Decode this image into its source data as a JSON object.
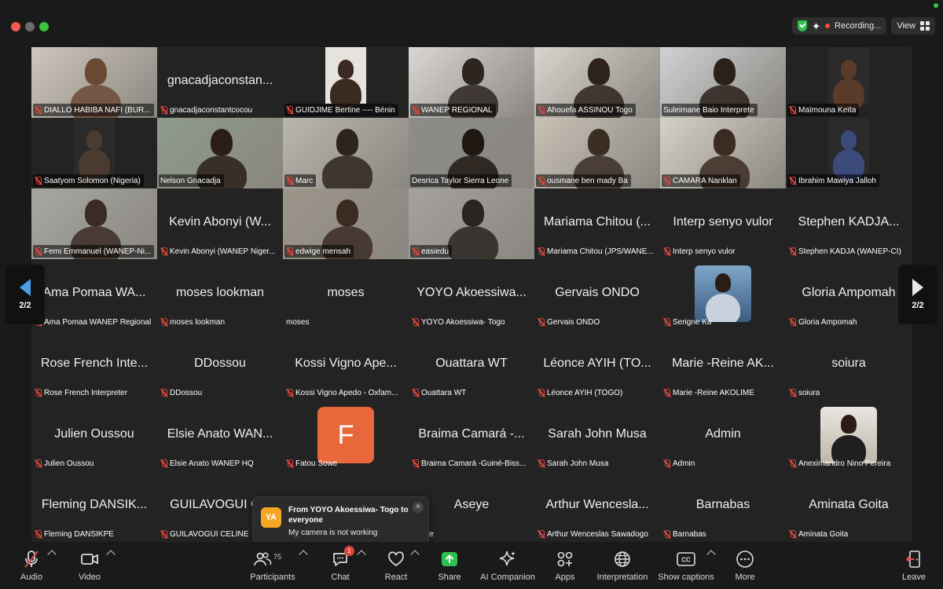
{
  "topbar": {
    "recording_label": "Recording...",
    "view_label": "View"
  },
  "grid": [
    {
      "big": "",
      "label": "DIALLO HABIBA NAFI (BUR...",
      "video": true,
      "muted": true
    },
    {
      "big": "gnacadjaconstan...",
      "label": "gnacadjaconstantcocou",
      "video": false,
      "muted": true
    },
    {
      "big": "",
      "label": "GUIDJIME Bertine ----  Bénin",
      "video": true,
      "muted": true
    },
    {
      "big": "",
      "label": "WANEP REGIONAL",
      "video": true,
      "muted": true
    },
    {
      "big": "",
      "label": "Ahouefa ASSINOU Togo",
      "video": true,
      "muted": true
    },
    {
      "big": "",
      "label": "Suleimane Baio Interprete",
      "video": true,
      "muted": false
    },
    {
      "big": "",
      "label": "Maïmouna Keïta",
      "video": true,
      "muted": true
    },
    {
      "big": "",
      "label": "Saatyom Solomon (Nigeria)",
      "video": true,
      "muted": true
    },
    {
      "big": "",
      "label": "Nelson Gnacadja",
      "video": true,
      "muted": false,
      "active": true
    },
    {
      "big": "",
      "label": "Marc",
      "video": true,
      "muted": true
    },
    {
      "big": "",
      "label": "Desrica Taylor Sierra Leone",
      "video": true,
      "muted": false
    },
    {
      "big": "",
      "label": "ousmane ben mady Ba",
      "video": true,
      "muted": true
    },
    {
      "big": "",
      "label": "CAMARA Nanklan",
      "video": true,
      "muted": true
    },
    {
      "big": "",
      "label": "Ibrahim Mawiya Jalloh",
      "video": true,
      "muted": true
    },
    {
      "big": "",
      "label": "Femi Emmanuel (WANEP-Ni...",
      "video": true,
      "muted": true
    },
    {
      "big": "Kevin Abonyi (W...",
      "label": "Kevin Abonyi (WANEP Niger...",
      "video": false,
      "muted": true
    },
    {
      "big": "",
      "label": "edwige mensah",
      "video": true,
      "muted": true
    },
    {
      "big": "",
      "label": "easiedu",
      "video": true,
      "muted": true
    },
    {
      "big": "Mariama Chitou (...",
      "label": "Mariama Chitou (JPS/WANE...",
      "video": false,
      "muted": true
    },
    {
      "big": "Interp senyo vulor",
      "label": "Interp senyo vulor",
      "video": false,
      "muted": true
    },
    {
      "big": "Stephen KADJA...",
      "label": "Stephen KADJA (WANEP-CI)",
      "video": false,
      "muted": true
    },
    {
      "big": "Ama Pomaa WA...",
      "label": "Ama Pomaa WANEP Regional",
      "video": false,
      "muted": true
    },
    {
      "big": "moses lookman",
      "label": "moses lookman",
      "video": false,
      "muted": true
    },
    {
      "big": "moses",
      "label": "moses",
      "video": false,
      "muted": false
    },
    {
      "big": "YOYO Akoessiwa...",
      "label": "YOYO Akoessiwa- Togo",
      "video": false,
      "muted": true
    },
    {
      "big": "Gervais ONDO",
      "label": "Gervais ONDO",
      "video": false,
      "muted": true
    },
    {
      "big": "",
      "label": "Serigne Ka",
      "video": false,
      "muted": true,
      "photo": "portrait-man"
    },
    {
      "big": "Gloria Ampomah",
      "label": "Gloria Ampomah",
      "video": false,
      "muted": true
    },
    {
      "big": "Rose French Inte...",
      "label": "Rose French Interpreter",
      "video": false,
      "muted": true
    },
    {
      "big": "DDossou",
      "label": "DDossou",
      "video": false,
      "muted": true
    },
    {
      "big": "Kossi Vigno Ape...",
      "label": "Kossi Vigno Apedo - Oxfam...",
      "video": false,
      "muted": true
    },
    {
      "big": "Ouattara WT",
      "label": "Ouattara WT",
      "video": false,
      "muted": true
    },
    {
      "big": "Léonce AYIH (TO...",
      "label": "Léonce AYIH (TOGO)",
      "video": false,
      "muted": true
    },
    {
      "big": "Marie -Reine AK...",
      "label": "Marie -Reine AKOLIME",
      "video": false,
      "muted": true
    },
    {
      "big": "soiura",
      "label": "soiura",
      "video": false,
      "muted": true
    },
    {
      "big": "Julien Oussou",
      "label": "Julien Oussou",
      "video": false,
      "muted": true
    },
    {
      "big": "Elsie Anato WAN...",
      "label": "Elsie Anato WANEP HQ",
      "video": false,
      "muted": true
    },
    {
      "big": "",
      "label": "Fatou Sowe",
      "video": false,
      "muted": true,
      "letter": "F"
    },
    {
      "big": "Braima Camará -...",
      "label": "Braima Camará -Guiné-Biss...",
      "video": false,
      "muted": true
    },
    {
      "big": "Sarah John Musa",
      "label": "Sarah John Musa",
      "video": false,
      "muted": true
    },
    {
      "big": "Admin",
      "label": "Admin",
      "video": false,
      "muted": true
    },
    {
      "big": "",
      "label": "Aneximandro Nino Pereira",
      "video": false,
      "muted": true,
      "photo": "portrait-family"
    },
    {
      "big": "Fleming DANSIK...",
      "label": "Fleming DANSIKPE",
      "video": false,
      "muted": true
    },
    {
      "big": "GUILAVOGUI C...",
      "label": "GUILAVOGUI CELINE",
      "video": false,
      "muted": true
    },
    {
      "big": "",
      "label": "",
      "video": false,
      "muted": false
    },
    {
      "big": "Aseye",
      "label": "Aseye",
      "video": false,
      "muted": false
    },
    {
      "big": "Arthur Wencesla...",
      "label": "Arthur Wenceslas Sawadogo",
      "video": false,
      "muted": true
    },
    {
      "big": "Barnabas",
      "label": "Barnabas",
      "video": false,
      "muted": true
    },
    {
      "big": "Aminata Goita",
      "label": "Aminata Goita",
      "video": false,
      "muted": true
    }
  ],
  "pager": {
    "left": "2/2",
    "right": "2/2"
  },
  "toast": {
    "avatar": "YA",
    "from": "From YOYO Akoessiwa- Togo to everyone",
    "message": "My camera is not working",
    "close": "×"
  },
  "toolbar": {
    "audio": "Audio",
    "video": "Video",
    "participants": "Participants",
    "participants_count": "75",
    "chat": "Chat",
    "chat_badge": "1",
    "react": "React",
    "share": "Share",
    "ai_companion": "AI Companion",
    "apps": "Apps",
    "interpretation": "Interpretation",
    "show_captions": "Show captions",
    "more": "More",
    "leave": "Leave"
  },
  "colors": {
    "accent_green": "#4fc36a",
    "mute_red": "#e0483e",
    "share_green": "#2fbf4f",
    "avatar_orange": "#e8683b"
  }
}
